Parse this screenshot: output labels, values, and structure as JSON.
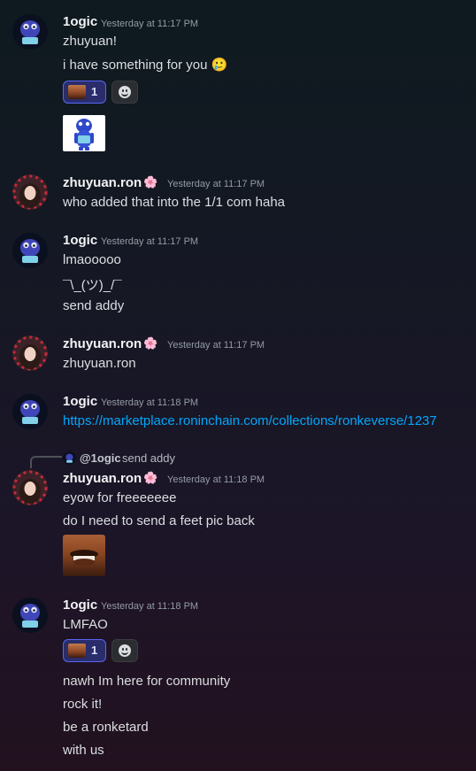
{
  "users": {
    "logic": "1ogic",
    "zhu": "zhuyuan.ron",
    "zhu_flower": "🌸"
  },
  "messages": [
    {
      "author": "1ogic",
      "time": "Yesterday at 11:17 PM",
      "lines": [
        "zhuyuan!",
        "i have something for you 🥲"
      ]
    },
    {
      "author": "zhuyuan.ron",
      "time": "Yesterday at 11:17 PM",
      "lines": [
        "who added that into the 1/1 com haha"
      ]
    },
    {
      "author": "1ogic",
      "time": "Yesterday at 11:17 PM",
      "lines": [
        "lmaooooo",
        "¯\\_(ツ)_/¯",
        "send addy"
      ]
    },
    {
      "author": "zhuyuan.ron",
      "time": "Yesterday at 11:17 PM",
      "lines": [
        "zhuyuan.ron"
      ]
    },
    {
      "author": "1ogic",
      "time": "Yesterday at 11:18 PM",
      "lines": [
        "https://marketplace.roninchain.com/collections/ronkeverse/1237"
      ]
    },
    {
      "author": "zhuyuan.ron",
      "time": "Yesterday at 11:18 PM",
      "lines": [
        "eyow for freeeeeee",
        "do I need to send a feet pic back"
      ]
    },
    {
      "author": "1ogic",
      "time": "Yesterday at 11:18 PM",
      "lines": [
        "LMFAO",
        "nawh Im here for community",
        "rock it!",
        "be a ronketard",
        "with us"
      ]
    }
  ],
  "reply": {
    "mention": "@1ogic",
    "text": "send addy"
  },
  "reactions": [
    {
      "count": "1"
    },
    {
      "count": "1"
    }
  ],
  "colors": {
    "link": "#00a8fc",
    "reaction_border": "#5865f2"
  }
}
